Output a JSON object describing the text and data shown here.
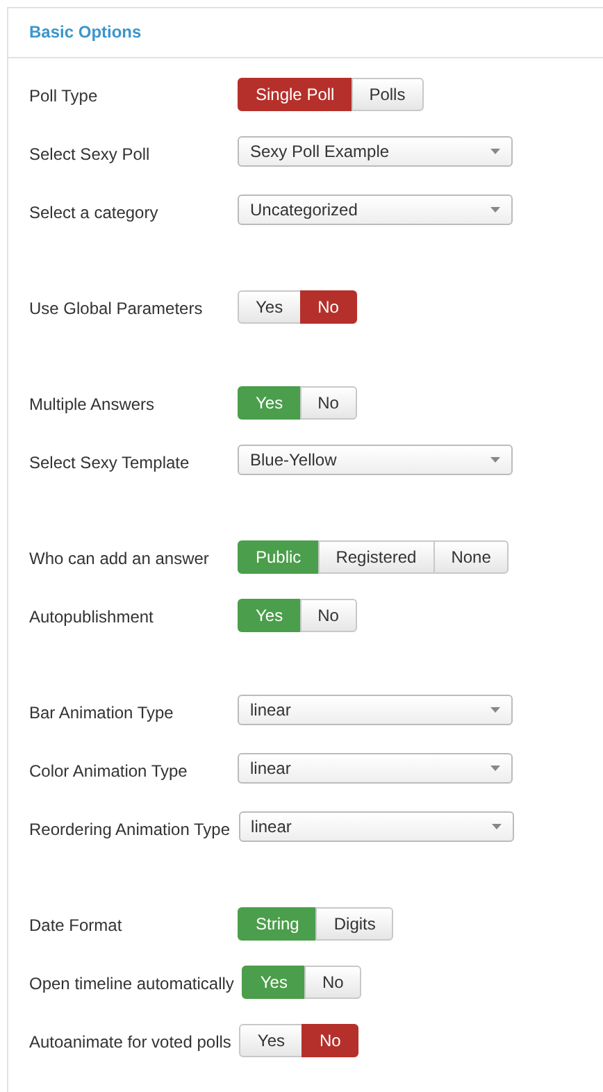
{
  "panel": {
    "title": "Basic Options"
  },
  "sections": [
    [
      {
        "kind": "buttons",
        "label": "Poll Type",
        "color": "#b5302a",
        "options": [
          {
            "label": "Single Poll",
            "selected": true
          },
          {
            "label": "Polls",
            "selected": false
          }
        ]
      },
      {
        "kind": "select",
        "label": "Select Sexy Poll",
        "value": "Sexy Poll Example"
      },
      {
        "kind": "select",
        "label": "Select a category",
        "value": "Uncategorized"
      }
    ],
    [
      {
        "kind": "buttons",
        "label": "Use Global Parameters",
        "color": "#b5302a",
        "options": [
          {
            "label": "Yes",
            "selected": false
          },
          {
            "label": "No",
            "selected": true
          }
        ]
      }
    ],
    [
      {
        "kind": "buttons",
        "label": "Multiple Answers",
        "color": "#4b9e4b",
        "options": [
          {
            "label": "Yes",
            "selected": true
          },
          {
            "label": "No",
            "selected": false
          }
        ]
      },
      {
        "kind": "select",
        "label": "Select Sexy Template",
        "value": "Blue-Yellow"
      }
    ],
    [
      {
        "kind": "buttons",
        "label": "Who can add an answer",
        "color": "#4b9e4b",
        "options": [
          {
            "label": "Public",
            "selected": true
          },
          {
            "label": "Registered",
            "selected": false
          },
          {
            "label": "None",
            "selected": false
          }
        ]
      },
      {
        "kind": "buttons",
        "label": "Autopublishment",
        "color": "#4b9e4b",
        "options": [
          {
            "label": "Yes",
            "selected": true
          },
          {
            "label": "No",
            "selected": false
          }
        ]
      }
    ],
    [
      {
        "kind": "select",
        "label": "Bar Animation Type",
        "value": "linear"
      },
      {
        "kind": "select",
        "label": "Color Animation Type",
        "value": "linear"
      },
      {
        "kind": "select",
        "label": "Reordering Animation Type",
        "value": "linear"
      }
    ],
    [
      {
        "kind": "buttons",
        "label": "Date Format",
        "color": "#4b9e4b",
        "options": [
          {
            "label": "String",
            "selected": true
          },
          {
            "label": "Digits",
            "selected": false
          }
        ]
      },
      {
        "kind": "buttons",
        "label": "Open timeline automatically",
        "color": "#4b9e4b",
        "options": [
          {
            "label": "Yes",
            "selected": true
          },
          {
            "label": "No",
            "selected": false
          }
        ]
      },
      {
        "kind": "buttons",
        "label": "Autoanimate for voted polls",
        "color": "#b5302a",
        "options": [
          {
            "label": "Yes",
            "selected": false
          },
          {
            "label": "No",
            "selected": true
          }
        ]
      }
    ]
  ]
}
